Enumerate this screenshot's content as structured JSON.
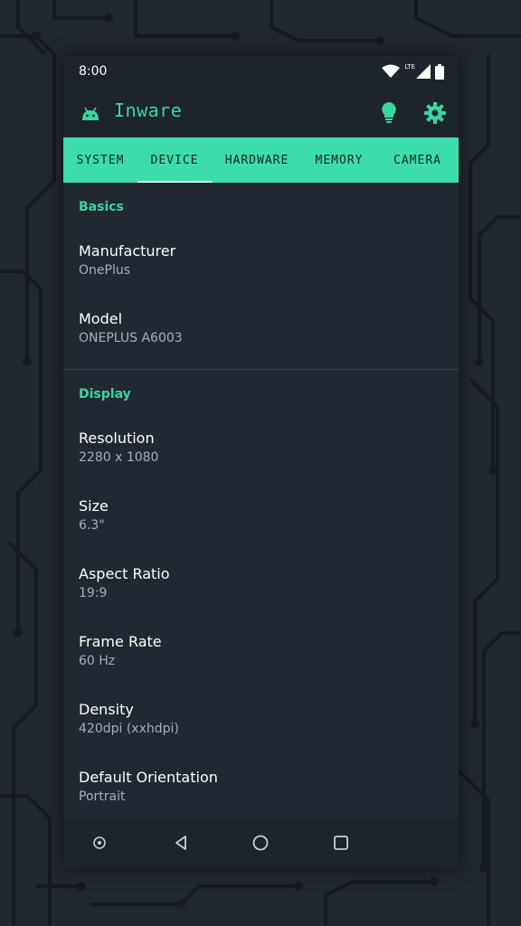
{
  "status_bar": {
    "time": "8:00",
    "network": "LTE"
  },
  "app": {
    "title": "Inware"
  },
  "tabs": [
    {
      "label": "SYSTEM",
      "active": false
    },
    {
      "label": "DEVICE",
      "active": true
    },
    {
      "label": "HARDWARE",
      "active": false
    },
    {
      "label": "MEMORY",
      "active": false
    },
    {
      "label": "CAMERA",
      "active": false
    }
  ],
  "sections": {
    "basics": {
      "header": "Basics",
      "items": [
        {
          "label": "Manufacturer",
          "value": "OnePlus"
        },
        {
          "label": "Model",
          "value": "ONEPLUS A6003"
        }
      ]
    },
    "display": {
      "header": "Display",
      "items": [
        {
          "label": "Resolution",
          "value": "2280 x 1080"
        },
        {
          "label": "Size",
          "value": "6.3\""
        },
        {
          "label": "Aspect Ratio",
          "value": "19:9"
        },
        {
          "label": "Frame Rate",
          "value": "60 Hz"
        },
        {
          "label": "Density",
          "value": "420dpi (xxhdpi)"
        },
        {
          "label": "Default Orientation",
          "value": "Portrait"
        }
      ]
    }
  },
  "icons": {
    "app_logo": "android-icon",
    "bulb": "lightbulb-icon",
    "settings": "gear-icon",
    "nav": [
      "assistant-icon",
      "back-icon",
      "home-icon",
      "recents-icon"
    ]
  },
  "colors": {
    "accent": "#3ddcab",
    "background": "#202831",
    "bar": "#1d242b"
  }
}
